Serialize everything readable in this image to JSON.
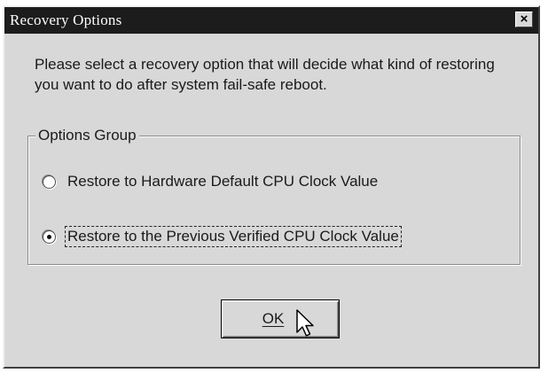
{
  "window": {
    "title": "Recovery Options",
    "close_label": "×"
  },
  "message": "Please select a recovery option that will decide what kind of restoring you want to do after system fail-safe reboot.",
  "options_group": {
    "label": "Options Group",
    "options": [
      {
        "label": "Restore to Hardware Default CPU Clock Value",
        "selected": false
      },
      {
        "label": "Restore to the Previous Verified CPU Clock Value",
        "selected": true
      }
    ]
  },
  "ok_button": {
    "label": "OK"
  },
  "icons": {
    "close": "close-icon",
    "cursor": "arrow-cursor-icon"
  },
  "colors": {
    "titlebar": "#1c1c1c",
    "dialog_face": "#d8d8d8"
  }
}
